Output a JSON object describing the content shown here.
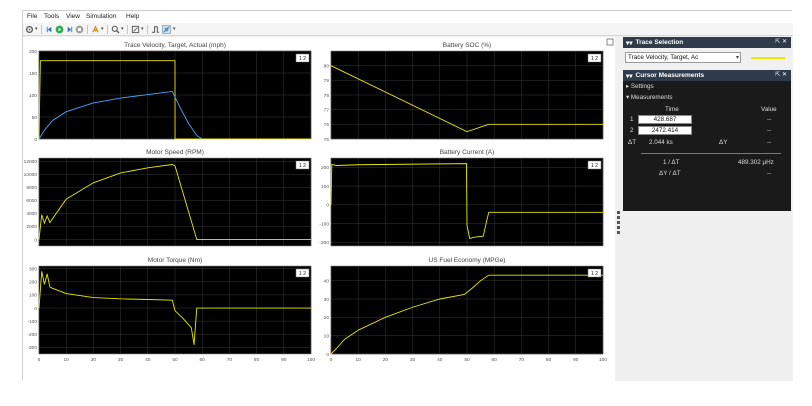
{
  "menubar": {
    "items": [
      "File",
      "Tools",
      "View",
      "Simulation",
      "Help"
    ]
  },
  "toolbar": {
    "icons": [
      "gear-icon",
      "step-back-icon",
      "run-icon",
      "step-forward-icon",
      "stop-icon",
      "highlight-icon",
      "zoom-icon",
      "autoscale-icon",
      "cursor-measure-icon",
      "trigger-icon"
    ]
  },
  "plots": [
    {
      "title": "Trace Velocity, Target, Actual (mph)",
      "badge": "1  2"
    },
    {
      "title": "Battery SOC (%)",
      "badge": "1  2"
    },
    {
      "title": "Motor Speed (RPM)",
      "badge": "1  2"
    },
    {
      "title": "Battery Current (A)",
      "badge": "1  2"
    },
    {
      "title": "Motor Torque (Nm)",
      "badge": "1  2"
    },
    {
      "title": "US Fuel Economy (MPGe)",
      "badge": "1  2"
    }
  ],
  "chart_data": [
    {
      "type": "line",
      "title": "Trace Velocity, Target, Actual (mph)",
      "xlim": [
        0,
        100
      ],
      "ylim": [
        0,
        200
      ],
      "yticks": [
        "200",
        "150",
        "100",
        "50",
        "0"
      ],
      "grid": true,
      "series": [
        {
          "color": "#e8e800",
          "x": [
            0,
            0.5,
            50,
            50.01,
            100
          ],
          "y": [
            0,
            178,
            178,
            0,
            0
          ]
        },
        {
          "color": "#4aa3ff",
          "x": [
            0,
            2,
            5,
            10,
            20,
            30,
            40,
            49,
            52,
            55,
            58,
            60
          ],
          "y": [
            0,
            20,
            42,
            62,
            82,
            93,
            101,
            108,
            70,
            35,
            8,
            0
          ]
        }
      ]
    },
    {
      "type": "line",
      "title": "Battery SOC (%)",
      "xlim": [
        0,
        100
      ],
      "ylim": [
        75,
        81
      ],
      "yticks": [
        "80",
        "79",
        "78",
        "77",
        "76",
        "75"
      ],
      "grid": true,
      "series": [
        {
          "color": "#e8e800",
          "x": [
            0,
            50,
            58,
            60,
            100
          ],
          "y": [
            80,
            75.5,
            76.0,
            76.0,
            76.0
          ]
        }
      ]
    },
    {
      "type": "line",
      "title": "Motor Speed (RPM)",
      "xlim": [
        0,
        100
      ],
      "ylim": [
        -1000,
        12500
      ],
      "yticks": [
        "12000",
        "10000",
        "8000",
        "6000",
        "4000",
        "2000",
        "0"
      ],
      "grid": true,
      "series": [
        {
          "color": "#e8e800",
          "x": [
            0,
            1,
            2,
            3,
            4,
            5,
            10,
            20,
            30,
            40,
            49,
            50,
            58,
            60,
            100
          ],
          "y": [
            0,
            3800,
            2500,
            3600,
            2600,
            3200,
            6200,
            8700,
            10200,
            11000,
            11500,
            11300,
            0,
            0,
            0
          ]
        }
      ]
    },
    {
      "type": "line",
      "title": "Battery Current (A)",
      "xlim": [
        0,
        100
      ],
      "ylim": [
        -220,
        250
      ],
      "yticks": [
        "200",
        "100",
        "0",
        "-100",
        "-200"
      ],
      "grid": true,
      "series": [
        {
          "color": "#e8e800",
          "x": [
            0,
            0.3,
            2,
            10,
            49.8,
            50,
            51,
            52,
            54,
            56,
            57,
            58,
            60,
            100
          ],
          "y": [
            0,
            215,
            210,
            214,
            220,
            -110,
            -180,
            -175,
            -170,
            -168,
            -100,
            -40,
            -40,
            -40
          ]
        }
      ]
    },
    {
      "type": "line",
      "title": "Motor Torque (Nm)",
      "xlim": [
        0,
        100
      ],
      "ylim": [
        -350,
        320
      ],
      "yticks": [
        "300",
        "200",
        "100",
        "0",
        "-100",
        "-200",
        "-300"
      ],
      "grid": true,
      "xticks": [
        "0",
        "10",
        "20",
        "30",
        "40",
        "50",
        "60",
        "70",
        "80",
        "90",
        "100"
      ],
      "series": [
        {
          "color": "#e8e800",
          "x": [
            0,
            1,
            2,
            3,
            4,
            5,
            10,
            20,
            30,
            40,
            49,
            50,
            53,
            56,
            57,
            58,
            59,
            100
          ],
          "y": [
            0,
            280,
            180,
            260,
            160,
            150,
            110,
            80,
            70,
            65,
            60,
            -20,
            -80,
            -150,
            -280,
            0,
            0,
            0
          ]
        }
      ]
    },
    {
      "type": "line",
      "title": "US Fuel Economy (MPGe)",
      "xlim": [
        0,
        100
      ],
      "ylim": [
        0,
        48
      ],
      "yticks": [
        "40",
        "30",
        "20",
        "10",
        "0"
      ],
      "grid": true,
      "xticks": [
        "0",
        "10",
        "20",
        "30",
        "40",
        "50",
        "60",
        "70",
        "80",
        "90",
        "100"
      ],
      "series": [
        {
          "color": "#e8e800",
          "x": [
            0,
            2,
            5,
            10,
            20,
            30,
            40,
            49,
            52,
            55,
            58,
            100
          ],
          "y": [
            0,
            3,
            8,
            13,
            20,
            25.5,
            30,
            32.5,
            36,
            40,
            43,
            43
          ]
        }
      ]
    }
  ],
  "trace_selection": {
    "title": "Trace Selection",
    "dropdown": "Trace Velocity, Target, Ac",
    "line_color": "#e8e800"
  },
  "cursor_measurements": {
    "title": "Cursor Measurements",
    "settings_label": "Settings",
    "measurements_label": "Measurements",
    "col_time": "Time",
    "col_value": "Value",
    "rows": [
      {
        "label": "1",
        "time": "428.687",
        "value": "--"
      },
      {
        "label": "2",
        "time": "2472.414",
        "value": "--"
      }
    ],
    "delta_t_label": "ΔT",
    "delta_t_value": "2.044 ks",
    "delta_y_label": "ΔY",
    "delta_y_value": "--",
    "inv_dt_label": "1 / ΔT",
    "inv_dt_value": "489.302 μHz",
    "dy_dt_label": "ΔY / ΔT",
    "dy_dt_value": "--"
  }
}
